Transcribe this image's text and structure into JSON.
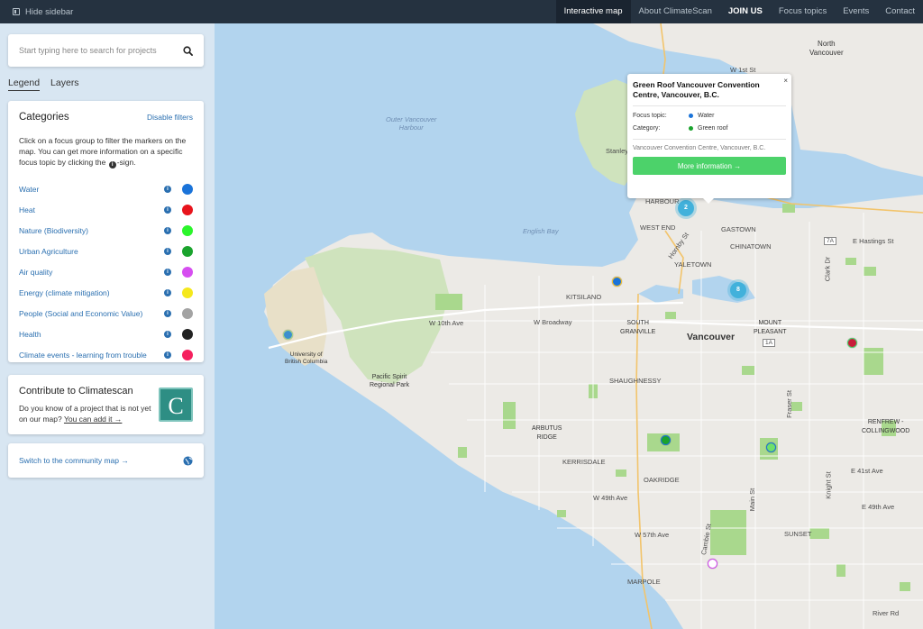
{
  "topbar": {
    "hide_sidebar": "Hide sidebar",
    "nav": [
      "Interactive map",
      "About ClimateScan",
      "JOIN US",
      "Focus topics",
      "Events",
      "Contact"
    ]
  },
  "sidebar": {
    "search_placeholder": "Start typing here to search for projects",
    "tabs": [
      "Legend",
      "Layers"
    ],
    "categories": {
      "title": "Categories",
      "disable": "Disable filters",
      "description": "Click on a focus group to filter the markers on the map. You can get more information on a specific focus topic by clicking the",
      "description_sign": "-sign.",
      "items": [
        {
          "label": "Water",
          "color": "#1a73d9"
        },
        {
          "label": "Heat",
          "color": "#e8141c"
        },
        {
          "label": "Nature (Biodiversity)",
          "color": "#2bf52b"
        },
        {
          "label": "Urban Agriculture",
          "color": "#1aa32d"
        },
        {
          "label": "Air quality",
          "color": "#d64ef0"
        },
        {
          "label": "Energy (climate mitigation)",
          "color": "#f5e81c"
        },
        {
          "label": "People (Social and Economic Value)",
          "color": "#a3a3a3"
        },
        {
          "label": "Health",
          "color": "#222222"
        },
        {
          "label": "Climate events - learning from trouble",
          "color": "#f5205e"
        }
      ]
    },
    "contribute": {
      "title": "Contribute to Climatescan",
      "text": "Do you know of a project that is not yet on our map?",
      "link": "You can add it →",
      "logo_letter": "C"
    },
    "community": {
      "link": "Switch to the community map →",
      "icon": "globe-icon"
    }
  },
  "map": {
    "labels": {
      "north_vancouver": "North\nVancouver",
      "outer_harbour": "Outer Vancouver\nHarbour",
      "english_bay": "English Bay",
      "stanley": "Stanley",
      "harbour": "HARBOUR",
      "west_end": "WEST END",
      "gastown": "GASTOWN",
      "chinatown": "CHINATOWN",
      "yaletown": "YALETOWN",
      "kitsilano": "KITSILANO",
      "south_granville": "SOUTH\nGRANVILLE",
      "vancouver": "Vancouver",
      "mount_pleasant": "MOUNT\nPLEASANT",
      "ubc": "University of\nBritish Columbia",
      "pacific_spirit": "Pacific Spirit\nRegional Park",
      "shaughnessy": "SHAUGHNESSY",
      "arbutus_ridge": "ARBUTUS\nRIDGE",
      "kerrisdale": "KERRISDALE",
      "oakridge": "OAKRIDGE",
      "sunset": "SUNSET",
      "marpole": "MARPOLE",
      "renfrew": "RENFREW -\nCOLLINGWOOD",
      "w10th": "W 10th Ave",
      "wbroadway": "W Broadway",
      "w49th": "W 49th Ave",
      "w57th": "W 57th Ave",
      "ehastings": "E Hastings St",
      "e41st": "E 41st Ave",
      "e49th": "E 49th Ave",
      "w1st": "W 1st St",
      "hornby": "Hornby St",
      "clark": "Clark Dr",
      "fraser": "Fraser St",
      "main": "Main St",
      "knight": "Knight St",
      "cambie": "Cambie St",
      "riverrd": "River Rd",
      "hwy1a": "1A",
      "hwy7a": "7A"
    },
    "clusters": [
      "2",
      "8"
    ],
    "popup": {
      "title": "Green Roof Vancouver Convention Centre, Vancouver, B.C.",
      "close": "×",
      "focus_label": "Focus topic:",
      "focus_value": "Water",
      "focus_color": "#1a73d9",
      "category_label": "Category:",
      "category_value": "Green roof",
      "category_color": "#1aa32d",
      "address": "Vancouver Convention Centre, Vancouver, B.C.",
      "button": "More information →"
    }
  }
}
